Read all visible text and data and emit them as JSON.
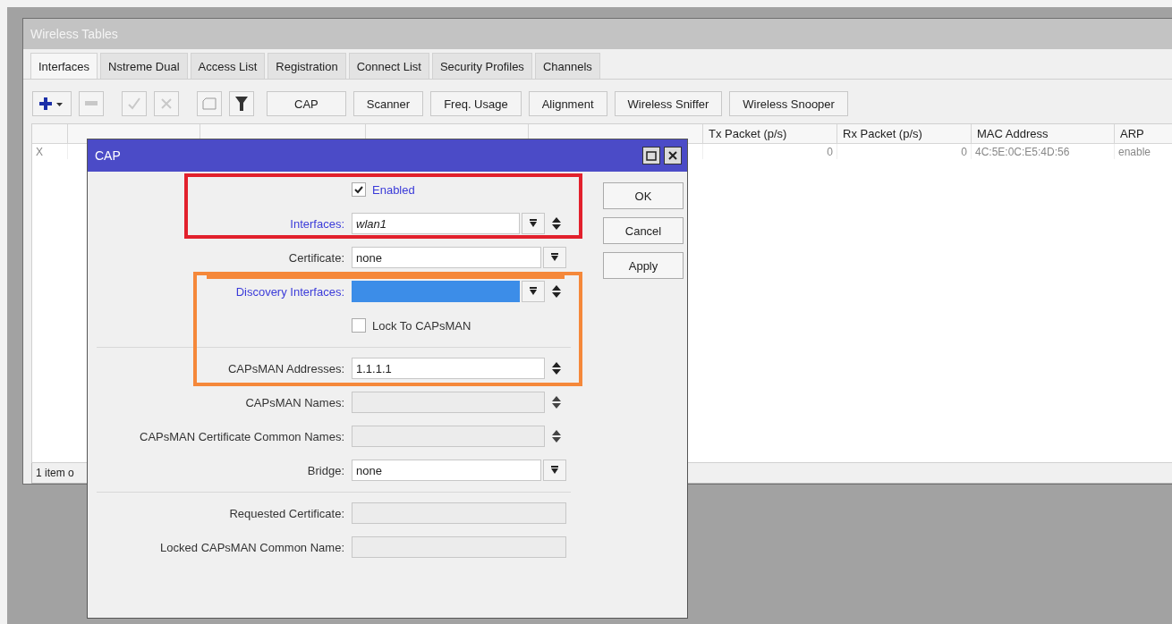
{
  "window": {
    "title": "Wireless Tables"
  },
  "tabs": [
    {
      "label": "Interfaces",
      "selected": true
    },
    {
      "label": "Nstreme Dual",
      "selected": false
    },
    {
      "label": "Access List",
      "selected": false
    },
    {
      "label": "Registration",
      "selected": false
    },
    {
      "label": "Connect List",
      "selected": false
    },
    {
      "label": "Security Profiles",
      "selected": false
    },
    {
      "label": "Channels",
      "selected": false
    }
  ],
  "toolbar": {
    "icons": [
      {
        "kind": "add",
        "disabled": false
      },
      {
        "kind": "remove",
        "disabled": true
      },
      {
        "kind": "enable",
        "disabled": true
      },
      {
        "kind": "disable",
        "disabled": true
      },
      {
        "kind": "comment",
        "disabled": true
      },
      {
        "kind": "filter",
        "disabled": false
      }
    ],
    "buttons": [
      "CAP",
      "Scanner",
      "Freq. Usage",
      "Alignment",
      "Wireless Sniffer",
      "Wireless Snooper"
    ]
  },
  "table": {
    "columns": [
      "",
      "",
      "",
      "",
      "",
      "Tx Packet (p/s)",
      "Rx Packet (p/s)",
      "MAC Address",
      "ARP"
    ],
    "rows": [
      [
        "X",
        "",
        "",
        "",
        "",
        "0",
        "0",
        "4C:5E:0C:E5:4D:56",
        "enable"
      ]
    ]
  },
  "status_bar": "1 item o",
  "dialog": {
    "title": "CAP",
    "rows": [
      {
        "kind": "checkbox",
        "label": "Enabled",
        "checked": true,
        "emphasized": true
      },
      {
        "kind": "field",
        "label": "Interfaces:",
        "value": "wlan1",
        "emphasized": true,
        "dropdown": true,
        "updown": true,
        "disabled": false
      },
      {
        "kind": "field",
        "label": "Certificate:",
        "value": "none",
        "emphasized": false,
        "dropdown": true,
        "updown": false,
        "disabled": false
      },
      {
        "kind": "field",
        "label": "Discovery Interfaces:",
        "emphasized": true,
        "highlighted": true,
        "dropdown": true,
        "updown": true,
        "disabled": false
      },
      {
        "kind": "checkbox",
        "label": "Lock To CAPsMAN",
        "checked": false,
        "emphasized": false
      },
      {
        "kind": "divider"
      },
      {
        "kind": "field",
        "label": "CAPsMAN Addresses:",
        "value": "1.1.1.1",
        "emphasized": false,
        "dropdown": false,
        "updown": true,
        "disabled": false
      },
      {
        "kind": "field",
        "label": "CAPsMAN Names:",
        "emphasized": false,
        "dropdown": false,
        "updown": true,
        "disabled": true
      },
      {
        "kind": "field",
        "label": "CAPsMAN Certificate Common Names:",
        "emphasized": false,
        "dropdown": false,
        "updown": true,
        "disabled": true
      },
      {
        "kind": "field",
        "label": "Bridge:",
        "value": "none",
        "emphasized": false,
        "dropdown": true,
        "updown": false,
        "disabled": false
      },
      {
        "kind": "divider"
      },
      {
        "kind": "field",
        "label": "Requested Certificate:",
        "emphasized": false,
        "dropdown": false,
        "updown": false,
        "disabled": true
      },
      {
        "kind": "field",
        "label": "Locked CAPsMAN Common Name:",
        "emphasized": false,
        "dropdown": false,
        "updown": false,
        "disabled": true
      }
    ],
    "buttons": [
      "OK",
      "Cancel",
      "Apply"
    ]
  },
  "annotations": [
    {
      "kind": "box",
      "color": "#e2202c"
    },
    {
      "kind": "box",
      "color": "#f5883a"
    },
    {
      "kind": "strike",
      "color": "#f5883a"
    }
  ]
}
